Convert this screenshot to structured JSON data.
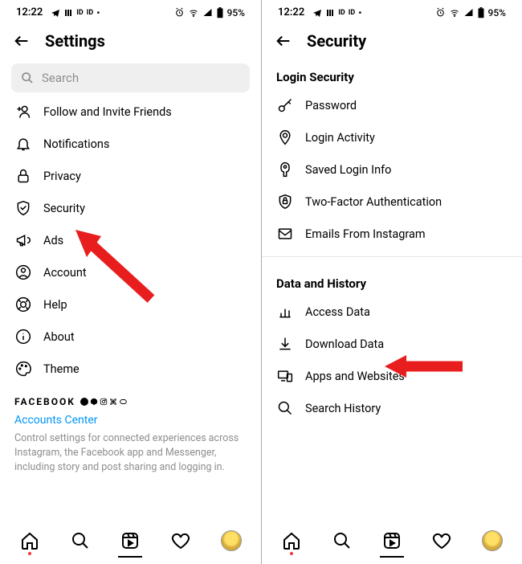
{
  "status": {
    "time": "12:22",
    "battery": "95%"
  },
  "left": {
    "title": "Settings",
    "search_placeholder": "Search",
    "items": [
      {
        "label": "Follow and Invite Friends"
      },
      {
        "label": "Notifications"
      },
      {
        "label": "Privacy"
      },
      {
        "label": "Security"
      },
      {
        "label": "Ads"
      },
      {
        "label": "Account"
      },
      {
        "label": "Help"
      },
      {
        "label": "About"
      },
      {
        "label": "Theme"
      }
    ],
    "brand": "FACEBOOK",
    "accounts_center": "Accounts Center",
    "desc": "Control settings for connected experiences across Instagram, the Facebook app and Messenger, including story and post sharing and logging in."
  },
  "right": {
    "title": "Security",
    "section1": "Login Security",
    "items1": [
      {
        "label": "Password"
      },
      {
        "label": "Login Activity"
      },
      {
        "label": "Saved Login Info"
      },
      {
        "label": "Two-Factor Authentication"
      },
      {
        "label": "Emails From Instagram"
      }
    ],
    "section2": "Data and History",
    "items2": [
      {
        "label": "Access Data"
      },
      {
        "label": "Download Data"
      },
      {
        "label": "Apps and Websites"
      },
      {
        "label": "Search History"
      }
    ]
  }
}
